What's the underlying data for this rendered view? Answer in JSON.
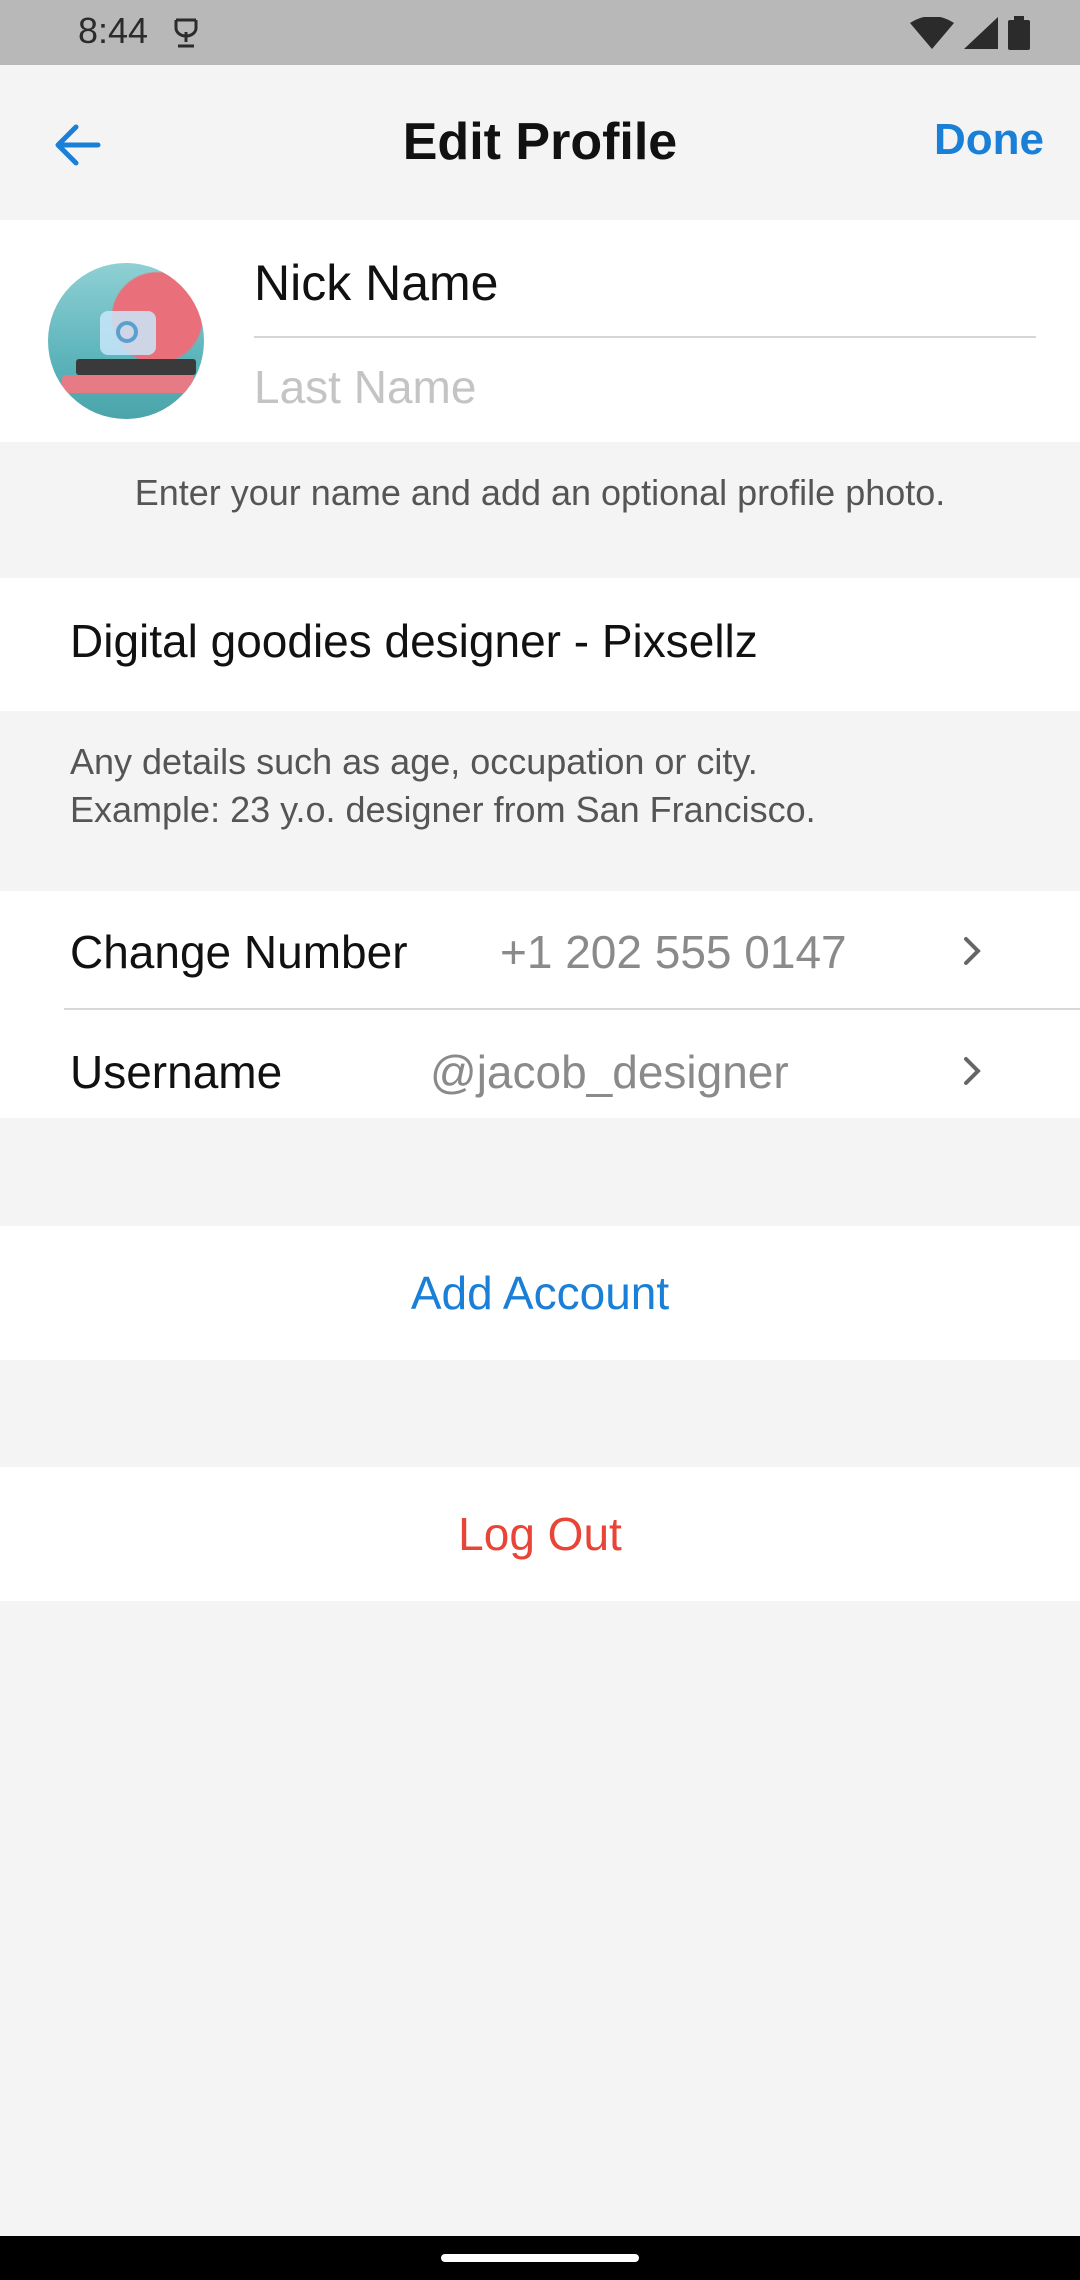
{
  "status_bar": {
    "time": "8:44"
  },
  "header": {
    "title": "Edit Profile",
    "done_label": "Done"
  },
  "profile": {
    "first_name_value": "Nick Name",
    "last_name_placeholder": "Last Name",
    "hint": "Enter your name and add an optional profile photo."
  },
  "bio": {
    "value": "Digital goodies designer - Pixsellz",
    "hint_line1": "Any details such as age, occupation or city.",
    "hint_line2": "Example: 23 y.o. designer from San Francisco."
  },
  "rows": [
    {
      "label": "Change Number",
      "value": "+1 202 555 0147"
    },
    {
      "label": "Username",
      "value": "@jacob_designer"
    }
  ],
  "actions": {
    "add_account": "Add Account",
    "log_out": "Log Out"
  },
  "colors": {
    "accent": "#1a7fd6",
    "danger": "#e84538",
    "background": "#f4f4f4"
  },
  "icons": [
    "back-arrow-icon",
    "camera-icon",
    "chevron-right-icon",
    "wifi-icon",
    "signal-icon",
    "battery-icon"
  ]
}
